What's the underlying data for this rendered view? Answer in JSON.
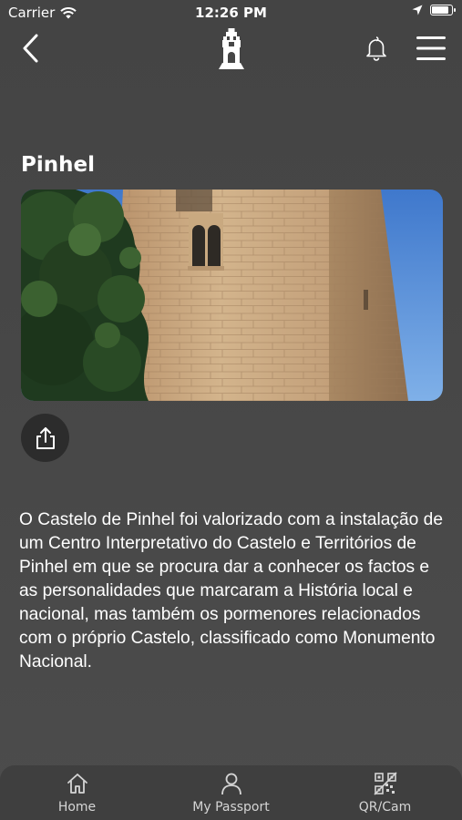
{
  "status_bar": {
    "carrier": "Carrier",
    "time": "12:26 PM",
    "battery_level": 0.9
  },
  "nav": {
    "back_icon": "chevron-left-icon",
    "logo": "castle-tower-logo",
    "bell_icon": "bell-icon",
    "menu_icon": "hamburger-menu-icon"
  },
  "page": {
    "title": "Pinhel",
    "hero_image": "castle-tower-photo",
    "share_icon": "share-icon",
    "description": "O Castelo de Pinhel foi valorizado com a instalação de um Centro Interpretativo do Castelo e Territórios de Pinhel em que se procura dar a conhecer os factos e as personalidades que marcaram a História local e nacional, mas também os pormenores relacionados com o próprio Castelo, classificado como Monumento Nacional."
  },
  "tabs": [
    {
      "label": "Home",
      "icon": "home-icon"
    },
    {
      "label": "My Passport",
      "icon": "user-icon"
    },
    {
      "label": "QR/Cam",
      "icon": "qr-code-icon"
    }
  ],
  "colors": {
    "background": "#464646",
    "tab_bar": "#3f3f3f",
    "share_button": "#2c2c2c",
    "sky": "#4f86d3",
    "stone": "#c9a77d"
  }
}
